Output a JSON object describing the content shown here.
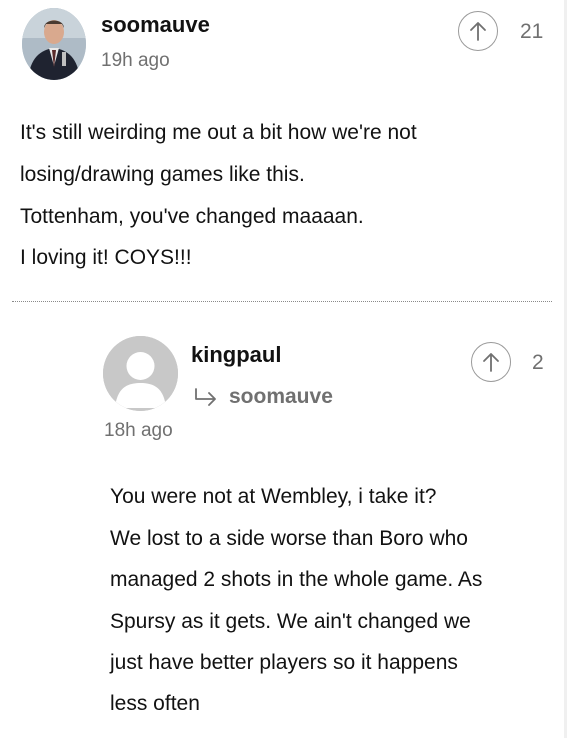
{
  "comments": [
    {
      "username": "soomauve",
      "timestamp": "19h ago",
      "votes": "21",
      "avatar_icon": "user-photo-icon",
      "lines": [
        "It's still weirding me out a bit how we're not",
        "losing/drawing games like this.",
        "Tottenham, you've changed maaaan.",
        "I loving it! COYS!!!"
      ]
    },
    {
      "username": "kingpaul",
      "reply_to": "soomauve",
      "timestamp": "18h ago",
      "votes": "2",
      "avatar_icon": "default-avatar-icon",
      "lines": [
        "You were not at Wembley, i take it?",
        "We lost to a side worse than Boro who",
        "managed 2 shots in the whole game. As",
        "Spursy as it gets. We ain't changed we",
        "just have better players so it happens",
        "less often"
      ]
    }
  ],
  "colors": {
    "text": "#121212",
    "muted": "#707070",
    "border": "#9a9a9a"
  }
}
